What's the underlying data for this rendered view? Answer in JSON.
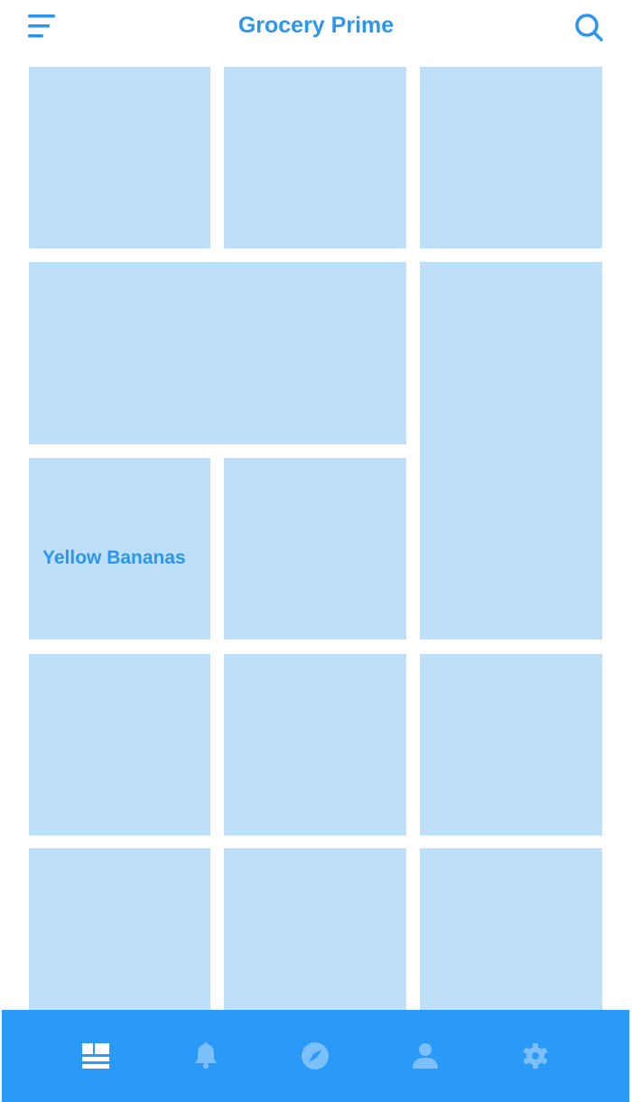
{
  "app": {
    "title": "Grocery Prime"
  },
  "header": {
    "menu_icon": "menu-icon",
    "search_icon": "search-icon"
  },
  "grid": {
    "tiles": [
      {
        "label": ""
      },
      {
        "label": ""
      },
      {
        "label": ""
      },
      {
        "label": ""
      },
      {
        "label": ""
      },
      {
        "label": "Yellow Bananas"
      },
      {
        "label": ""
      },
      {
        "label": ""
      },
      {
        "label": ""
      },
      {
        "label": ""
      },
      {
        "label": ""
      },
      {
        "label": ""
      },
      {
        "label": ""
      }
    ]
  },
  "bottom_nav": {
    "items": [
      {
        "icon": "dashboard-icon",
        "active": true
      },
      {
        "icon": "bell-icon",
        "active": false
      },
      {
        "icon": "compass-icon",
        "active": false
      },
      {
        "icon": "person-icon",
        "active": false
      },
      {
        "icon": "gear-icon",
        "active": false
      }
    ]
  },
  "colors": {
    "accent": "#2b96ec",
    "tile": "#bddff9",
    "nav_bg": "#2b99f8",
    "nav_icon_active": "#ffffff",
    "nav_icon_inactive": "#7cc0fb"
  }
}
